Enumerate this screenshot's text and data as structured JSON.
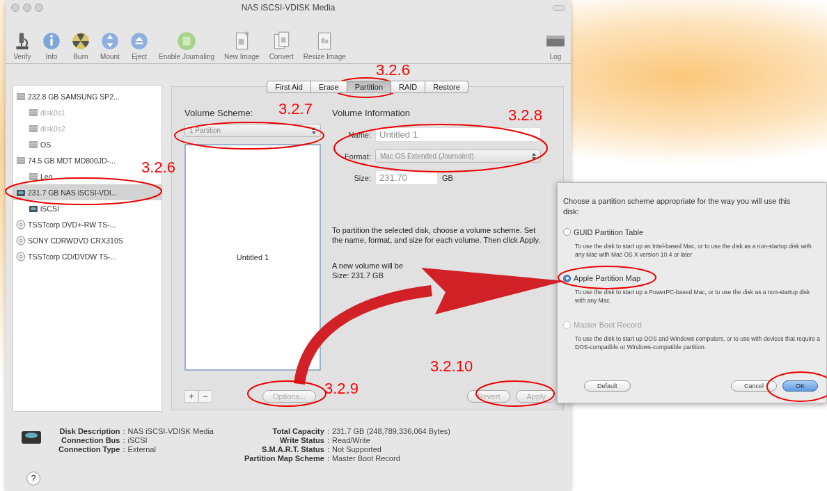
{
  "window": {
    "title": "NAS iSCSI-VDISK Media"
  },
  "toolbar": {
    "items": [
      {
        "label": "Verify"
      },
      {
        "label": "Info"
      },
      {
        "label": "Burn"
      },
      {
        "label": "Mount"
      },
      {
        "label": "Eject"
      },
      {
        "label": "Enable Journaling"
      },
      {
        "label": "New Image"
      },
      {
        "label": "Convert"
      },
      {
        "label": "Resize Image"
      }
    ],
    "log": {
      "label": "Log"
    }
  },
  "sidebar": {
    "items": [
      {
        "kind": "disk",
        "label": "232.8 GB SAMSUNG SP2...",
        "selected": false,
        "dimmed": false,
        "children": [
          {
            "kind": "volume",
            "label": "disk0s1",
            "selected": false,
            "dimmed": true
          },
          {
            "kind": "volume",
            "label": "disk0s2",
            "selected": false,
            "dimmed": true
          },
          {
            "kind": "volume",
            "label": "OS",
            "selected": false,
            "dimmed": false
          }
        ]
      },
      {
        "kind": "disk",
        "label": "74.5 GB MDT MD800JD-...",
        "selected": false,
        "dimmed": false,
        "children": [
          {
            "kind": "volume",
            "label": "Leo",
            "selected": false,
            "dimmed": false
          }
        ]
      },
      {
        "kind": "network-disk",
        "label": "231.7 GB NAS iSCSI-VDI...",
        "selected": true,
        "dimmed": false,
        "children": [
          {
            "kind": "network-volume",
            "label": "iSCSI",
            "selected": false,
            "dimmed": false
          }
        ]
      },
      {
        "kind": "optical",
        "label": "TSSTcorp DVD+-RW TS-...",
        "selected": false,
        "dimmed": false
      },
      {
        "kind": "optical",
        "label": "SONY CDRWDVD CRX310S",
        "selected": false,
        "dimmed": false
      },
      {
        "kind": "optical",
        "label": "TSSTcorp CD/DVDW TS-...",
        "selected": false,
        "dimmed": false
      }
    ]
  },
  "tabs": [
    {
      "label": "First Aid",
      "selected": false
    },
    {
      "label": "Erase",
      "selected": false
    },
    {
      "label": "Partition",
      "selected": true
    },
    {
      "label": "RAID",
      "selected": false
    },
    {
      "label": "Restore",
      "selected": false
    }
  ],
  "partition": {
    "volume_scheme": {
      "label": "Volume Scheme:",
      "value": "1 Partition",
      "disabled": true
    },
    "layout": {
      "volumes": [
        "Untitled 1"
      ]
    },
    "volume_information": {
      "title": "Volume Information",
      "name": {
        "label": "Name:",
        "value": "Untitled 1",
        "disabled": true
      },
      "format": {
        "label": "Format:",
        "value": "Mac OS Extended (Journaled)",
        "disabled": true
      },
      "size": {
        "label": "Size:",
        "value": "231.70",
        "unit": "GB",
        "disabled": true
      }
    },
    "help_text": "To partition the selected disk, choose a volume scheme. Set the name, format, and size for each volume. Then click Apply.",
    "summary": [
      "A new volume will be",
      "Size: 231.7 GB"
    ],
    "buttons": [
      {
        "kind": "add",
        "label": "+",
        "disabled": false
      },
      {
        "kind": "remove",
        "label": "−",
        "disabled": false
      },
      {
        "kind": "options",
        "label": "Options...",
        "disabled": true
      },
      {
        "kind": "revert",
        "label": "Revert",
        "disabled": true
      },
      {
        "kind": "apply",
        "label": "Apply",
        "disabled": true
      }
    ]
  },
  "disk_info": {
    "separator": ":",
    "left": [
      {
        "label": "Disk Description",
        "value": "NAS iSCSI-VDISK Media"
      },
      {
        "label": "Connection Bus",
        "value": "iSCSI"
      },
      {
        "label": "Connection Type",
        "value": "External"
      }
    ],
    "right": [
      {
        "label": "Total Capacity",
        "value": "231.7 GB (248,789,336,064 Bytes)"
      },
      {
        "label": "Write Status",
        "value": "Read/Write"
      },
      {
        "label": "S.M.A.R.T. Status",
        "value": "Not Supported"
      },
      {
        "label": "Partition Map Scheme",
        "value": "Master Boot Record"
      }
    ]
  },
  "help_button": {
    "label": "?"
  },
  "dialog": {
    "prompt": "Choose a partition scheme appropriate for the way you will use this disk:",
    "options": [
      {
        "label": "GUID Partition Table",
        "description": "To use the disk to start up an Intel-based Mac, or to use the disk as a non-startup disk with any Mac with Mac OS X version 10.4 or later",
        "selected": false,
        "disabled": false
      },
      {
        "label": "Apple Partition Map",
        "description": "To use the disk to start up a PowerPC-based Mac, or to use the disk as a non-startup disk with any Mac.",
        "selected": true,
        "disabled": false
      },
      {
        "label": "Master Boot Record",
        "description": "To use the disk to start up DOS and Windows computers, or to use with devices that require a DOS-compatible or Windows-compatible partition.",
        "selected": false,
        "disabled": true
      }
    ],
    "buttons": [
      {
        "label": "Default",
        "default": false
      },
      {
        "label": "Cancel",
        "default": false
      },
      {
        "label": "OK",
        "default": true
      }
    ]
  },
  "annotations": {
    "labels": [
      "3.2.6",
      "3.2.7",
      "3.2.8",
      "3.2.6",
      "3.2.9",
      "3.2.10"
    ]
  }
}
